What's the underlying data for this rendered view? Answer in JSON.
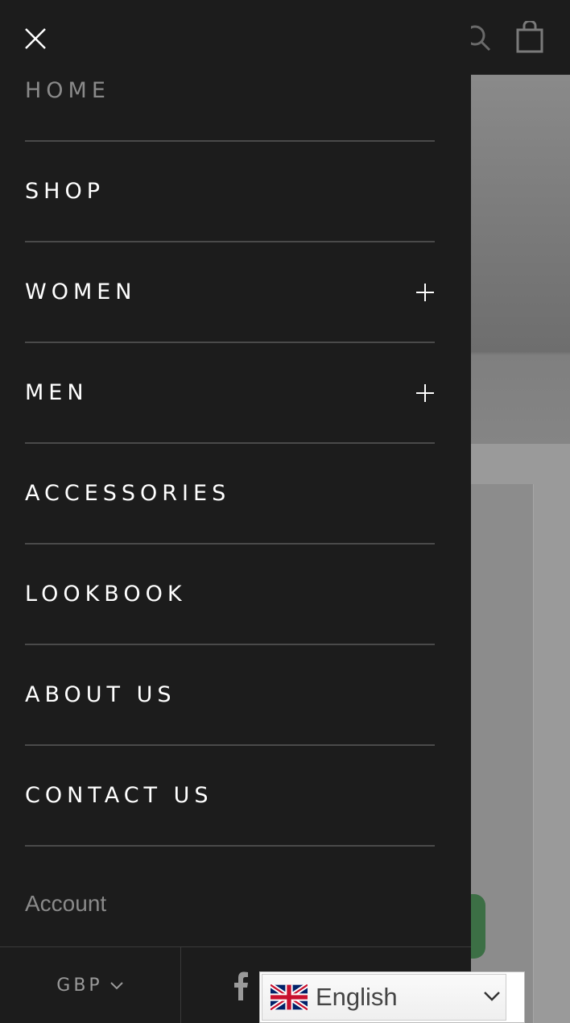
{
  "colors": {
    "drawer_bg": "#1c1c1c",
    "menu_text": "#ffffff",
    "muted_text": "#8a8a8a",
    "divider": "#4a4a4a"
  },
  "header": {
    "close_icon": "close-icon",
    "search_icon": "search-icon",
    "cart_icon": "shopping-bag-icon"
  },
  "menu": {
    "items": [
      {
        "label": "HOME",
        "expandable": false
      },
      {
        "label": "SHOP",
        "expandable": false
      },
      {
        "label": "WOMEN",
        "expandable": true
      },
      {
        "label": "MEN",
        "expandable": true
      },
      {
        "label": "ACCESSORIES",
        "expandable": false
      },
      {
        "label": "LOOKBOOK",
        "expandable": false
      },
      {
        "label": "ABOUT US",
        "expandable": false
      },
      {
        "label": "CONTACT US",
        "expandable": false
      }
    ]
  },
  "account_label": "Account",
  "footer": {
    "currency": "GBP",
    "social_icon": "facebook-icon"
  },
  "language": {
    "selected": "English",
    "flag_icon": "uk-flag-icon"
  }
}
